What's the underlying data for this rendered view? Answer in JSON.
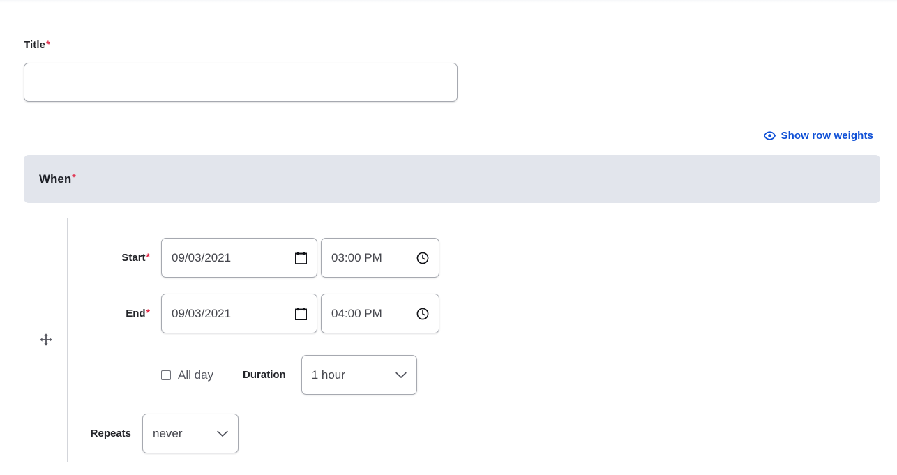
{
  "page": {
    "required_marker": "*"
  },
  "title_field": {
    "label": "Title",
    "value": "",
    "placeholder": ""
  },
  "row_weights": {
    "label": "Show row weights",
    "icon": "eye-icon",
    "color": "#0f50d6"
  },
  "when_section": {
    "label": "When",
    "background": "#e2e5ec"
  },
  "drag": {
    "icon": "move-handle-icon"
  },
  "start_row": {
    "label": "Start",
    "date_value": "09/03/2021",
    "date_icon": "calendar-icon",
    "time_value": "03:00 PM",
    "time_icon": "clock-icon"
  },
  "end_row": {
    "label": "End",
    "date_value": "09/03/2021",
    "date_icon": "calendar-icon",
    "time_value": "04:00 PM",
    "time_icon": "clock-icon"
  },
  "allday_row": {
    "checkbox_label": "All day",
    "checked": false,
    "duration_label": "Duration",
    "duration_value": "1 hour",
    "duration_icon": "chevron-down-icon"
  },
  "repeats_row": {
    "label": "Repeats",
    "value": "never",
    "icon": "chevron-down-icon"
  }
}
